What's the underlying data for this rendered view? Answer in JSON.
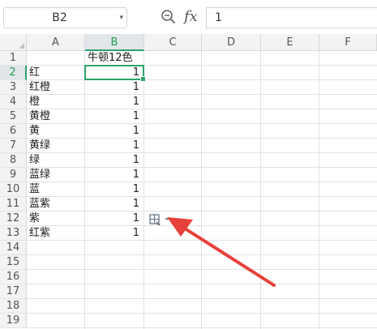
{
  "formula_bar": {
    "name_box": "B2",
    "formula_value": "1",
    "fx_label": "fx",
    "zoom_icon": "zoom-icon",
    "dropdown_icon": "chevron-down-icon"
  },
  "grid": {
    "columns": [
      "A",
      "B",
      "C",
      "D",
      "E",
      "F"
    ],
    "selected_column": "B",
    "rows": [
      "1",
      "2",
      "3",
      "4",
      "5",
      "6",
      "7",
      "8",
      "9",
      "10",
      "11",
      "12",
      "13",
      "14",
      "15",
      "16",
      "17",
      "18",
      "19"
    ],
    "selected_row": "2",
    "header_cell": "牛顿12色",
    "colors": [
      "红",
      "红橙",
      "橙",
      "黄橙",
      "黄",
      "黄绿",
      "绿",
      "蓝绿",
      "蓝",
      "蓝紫",
      "紫",
      "红紫"
    ],
    "values": [
      "1",
      "1",
      "1",
      "1",
      "1",
      "1",
      "1",
      "1",
      "1",
      "1",
      "1",
      "1"
    ]
  },
  "annotation": {
    "arrow_color": "#e8403a",
    "autofill_icon": "autofill-options-icon"
  },
  "theme": {
    "accent": "#2ea36b",
    "header_bg": "#f3f3f3",
    "grid_line": "#e2e2e2"
  }
}
